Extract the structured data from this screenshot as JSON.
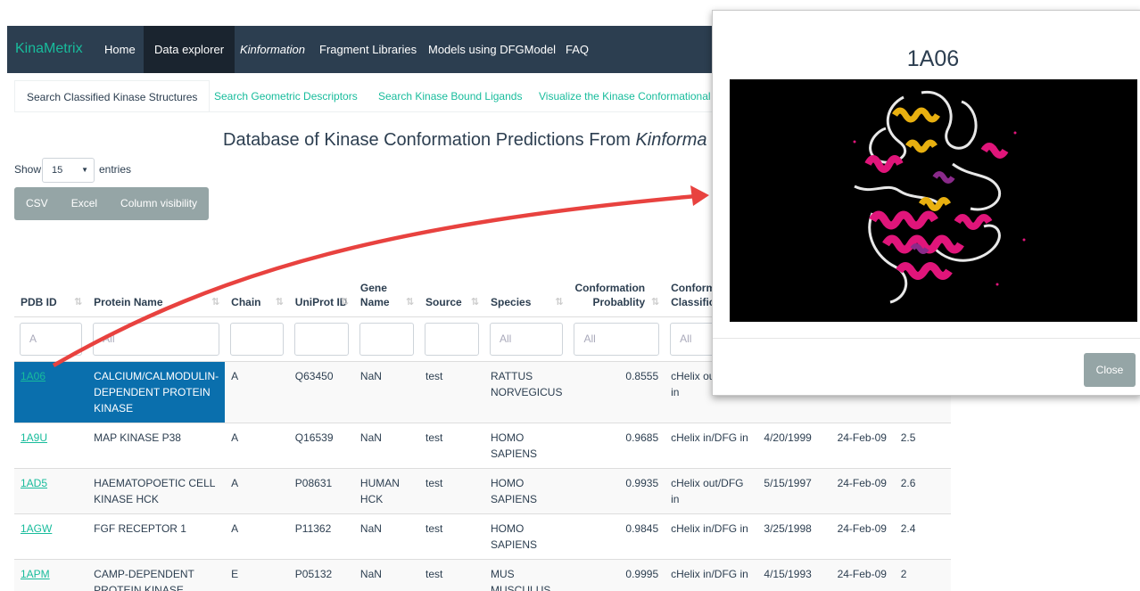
{
  "navbar": {
    "brand": "KinaMetrix",
    "items": [
      "Home",
      "Data explorer",
      "Kinformation",
      "Fragment Libraries",
      "Models using DFGModel",
      "FAQ"
    ]
  },
  "tabs": [
    "Search Classified Kinase Structures",
    "Search Geometric Descriptors",
    "Search Kinase Bound Ligands",
    "Visualize the Kinase Conformational S"
  ],
  "title": {
    "prefix": "Database of Kinase Conformation Predictions From ",
    "italic": "Kinforma"
  },
  "length": {
    "show": "Show",
    "value": "15",
    "entries": "entries"
  },
  "buttons": [
    "CSV",
    "Excel",
    "Column visibility"
  ],
  "table": {
    "headers": [
      "PDB ID",
      "Protein Name",
      "Chain",
      "UniProt ID",
      "Gene Name",
      "Source",
      "Species",
      "Conformation Probablity",
      "Conforma Classificat"
    ],
    "filters": [
      "A",
      "All",
      "",
      "",
      "",
      "",
      "All",
      "All",
      "All"
    ],
    "rows": [
      [
        "1A06",
        "CALCIUM/CALMODULIN-DEPENDENT PROTEIN KINASE",
        "A",
        "Q63450",
        "NaN",
        "test",
        "RATTUS NORVEGICUS",
        "0.8555",
        "cHelix out/DFG in",
        "",
        "",
        ""
      ],
      [
        "1A9U",
        "MAP KINASE P38",
        "A",
        "Q16539",
        "NaN",
        "test",
        "HOMO SAPIENS",
        "0.9685",
        "cHelix in/DFG in",
        "4/20/1999",
        "24-Feb-09",
        "2.5"
      ],
      [
        "1AD5",
        "HAEMATOPOETIC CELL KINASE HCK",
        "A",
        "P08631",
        "HUMAN HCK",
        "test",
        "HOMO SAPIENS",
        "0.9935",
        "cHelix out/DFG in",
        "5/15/1997",
        "24-Feb-09",
        "2.6"
      ],
      [
        "1AGW",
        "FGF RECEPTOR 1",
        "A",
        "P11362",
        "NaN",
        "test",
        "HOMO SAPIENS",
        "0.9845",
        "cHelix in/DFG in",
        "3/25/1998",
        "24-Feb-09",
        "2.4"
      ],
      [
        "1APM",
        "CAMP-DEPENDENT PROTEIN KINASE",
        "E",
        "P05132",
        "NaN",
        "test",
        "MUS MUSCULUS",
        "0.9995",
        "cHelix in/DFG in",
        "4/15/1993",
        "24-Feb-09",
        "2"
      ]
    ]
  },
  "modal": {
    "title": "1A06",
    "close": "Close"
  },
  "colors": {
    "navbar": "#2c3e50",
    "accent": "#18bc9c",
    "selected": "#0a6fad",
    "button": "#95a5a6",
    "arrow": "#e8423f"
  }
}
